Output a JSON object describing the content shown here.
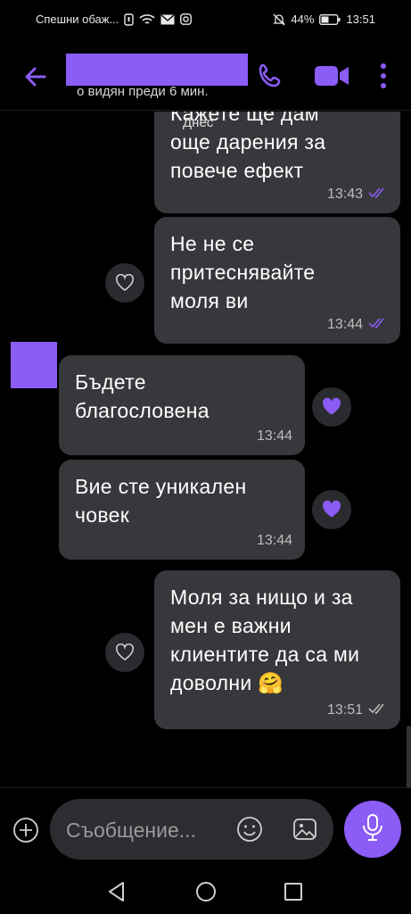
{
  "status_bar": {
    "left_text": "Спешни обаж...",
    "battery": "44%",
    "time": "13:51",
    "icons": [
      "sim-icon",
      "wifi-icon",
      "mail-icon",
      "instagram-icon",
      "mute-icon",
      "battery-icon"
    ]
  },
  "header": {
    "last_seen": "о видян преди 6 мин.",
    "icons": [
      "back-arrow-icon",
      "phone-icon",
      "video-icon",
      "more-icon"
    ],
    "accent_color": "#8b5cf6"
  },
  "chat": {
    "date_label": "Днес",
    "messages": [
      {
        "side": "out",
        "lines": [
          "Кажете ще дам",
          "още дарения за",
          "повече ефект"
        ],
        "time": "13:43",
        "status": "read"
      },
      {
        "side": "out",
        "lines": [
          "Не не се",
          "притеснявайте",
          "моля ви"
        ],
        "time": "13:44",
        "status": "read",
        "reaction": "heart-outline"
      },
      {
        "side": "in",
        "lines": [
          "Бъдете",
          "благословена"
        ],
        "time": "13:44",
        "reaction": "heart-filled"
      },
      {
        "side": "in",
        "lines": [
          "Вие сте уникален",
          "човек"
        ],
        "time": "13:44",
        "reaction": "heart-filled"
      },
      {
        "side": "out",
        "lines": [
          "Моля за нищо и за",
          "мен е важни",
          "клиентите да са ми",
          "доволни 🤗"
        ],
        "time": "13:51",
        "status": "delivered",
        "reaction": "heart-outline"
      }
    ]
  },
  "composer": {
    "placeholder": "Съобщение...",
    "icons": [
      "plus-icon",
      "emoji-icon",
      "gallery-icon",
      "mic-icon"
    ]
  },
  "nav_bar": {
    "icons": [
      "back-nav-icon",
      "home-nav-icon",
      "recents-nav-icon"
    ]
  }
}
